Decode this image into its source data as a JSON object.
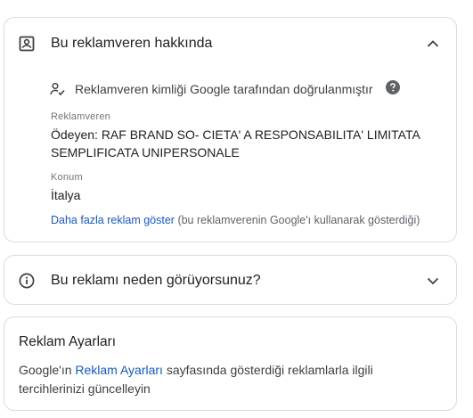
{
  "advertiser_card": {
    "title": "Bu reklamveren hakkında",
    "verified_text": "Reklamveren kimliği Google tarafından doğrulanmıştır",
    "advertiser_label": "Reklamveren",
    "advertiser_value": "Ödeyen: RAF BRAND SO- CIETA' A RESPONSABILITA' LIMITATA SEMPLIFICATA UNIPERSONALE",
    "location_label": "Konum",
    "location_value": "İtalya",
    "more_ads_link": "Daha fazla reklam göster",
    "more_ads_note": "(bu reklamverenin Google'ı kullanarak gösterdiği)"
  },
  "why_card": {
    "title": "Bu reklamı neden görüyorsunuz?"
  },
  "settings_card": {
    "title": "Reklam Ayarları",
    "text_prefix": "Google'ın ",
    "link": "Reklam Ayarları",
    "text_suffix": " sayfasında gösterdiği reklamlarla ilgili tercihlerinizi güncelleyin"
  },
  "colors": {
    "link": "#1558d6",
    "muted": "#70757a",
    "border": "#dadce0"
  }
}
